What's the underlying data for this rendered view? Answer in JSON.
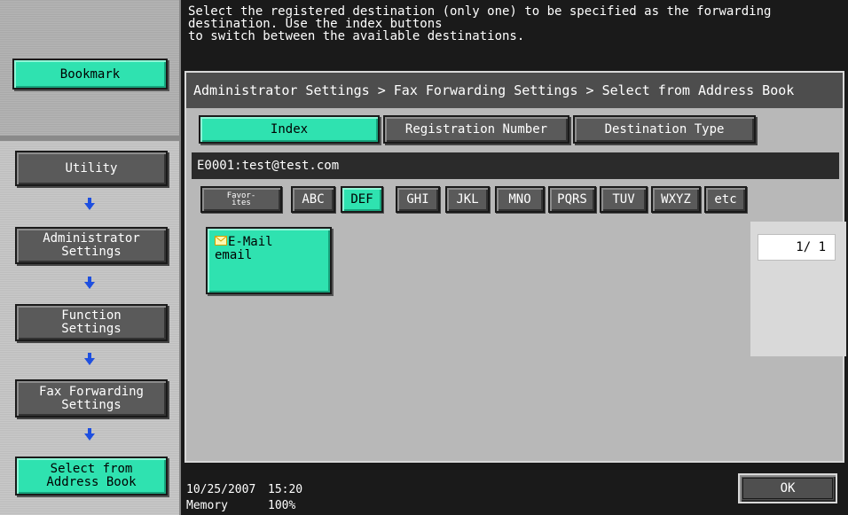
{
  "left_panel": {
    "bookmark_label": "Bookmark",
    "nav": [
      {
        "label": "Utility"
      },
      {
        "label": "Administrator\nSettings"
      },
      {
        "label": "Function\nSettings"
      },
      {
        "label": "Fax Forwarding\nSettings"
      },
      {
        "label": "Select from\nAddress Book",
        "active": true
      }
    ]
  },
  "message": "Select the registered destination (only one) to be specified as the forwarding\ndestination. Use the index buttons\nto switch between the available destinations.",
  "breadcrumb": "Administrator Settings > Fax Forwarding Settings > Select from Address Book",
  "tabs": [
    {
      "label": "Index",
      "active": true
    },
    {
      "label": "Registration Number",
      "active": false
    },
    {
      "label": "Destination Type",
      "active": false
    }
  ],
  "selected_destination": "E0001:test@test.com",
  "index_buttons": {
    "favorites": "Favor-\nites",
    "letters": [
      "ABC",
      "DEF",
      "GHI",
      "JKL",
      "MNO",
      "PQRS",
      "TUV",
      "WXYZ",
      "etc"
    ],
    "active": "DEF"
  },
  "destination": {
    "type_label": "E-Mail",
    "name": "email",
    "icon": "mail-icon"
  },
  "page_counter": "1/  1",
  "footer": {
    "date": "10/25/2007",
    "time": "15:20",
    "memory_label": "Memory",
    "memory_value": "100%",
    "ok_label": "OK"
  },
  "colors": {
    "accent": "#2fe2b0",
    "button_gray": "#5a5a5a",
    "background_dark": "#1a1a1a",
    "panel_gray": "#b8b8b8"
  }
}
